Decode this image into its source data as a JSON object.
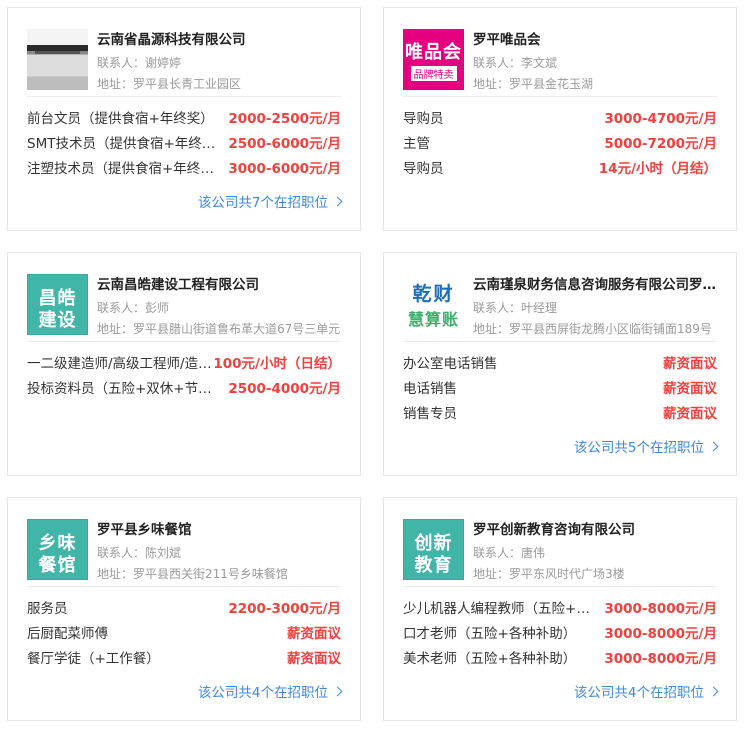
{
  "more_suffix_icon": "chevron-right-icon",
  "companies": [
    {
      "name": "云南省晶源科技有限公司",
      "contact": "联系人：谢婷婷",
      "address": "地址：罗平县长青工业园区",
      "logo": {
        "kind": "photo"
      },
      "jobs": [
        {
          "title": "前台文员（提供食宿+年终奖）",
          "salary": "2000-2500元/月"
        },
        {
          "title": "SMT技术员（提供食宿+年终奖）",
          "salary": "2500-6000元/月"
        },
        {
          "title": "注塑技术员（提供食宿+年终奖）",
          "salary": "3000-6000元/月"
        }
      ],
      "more": "该公司共7个在招职位"
    },
    {
      "name": "罗平唯品会",
      "contact": "联系人：李文斌",
      "address": "地址：罗平县金花玉湖",
      "logo": {
        "kind": "vip",
        "line1": "唯品会",
        "line2": "品牌特卖"
      },
      "jobs": [
        {
          "title": "导购员",
          "salary": "3000-4700元/月"
        },
        {
          "title": "主管",
          "salary": "5000-7200元/月"
        },
        {
          "title": "导购员",
          "salary": "14元/小时（月结）"
        }
      ],
      "more": ""
    },
    {
      "name": "云南昌皓建设工程有限公司",
      "contact": "联系人：彭师",
      "address": "地址：罗平县腊山街道鲁布革大道67号三单元",
      "logo": {
        "kind": "teal",
        "line1": "昌皓",
        "line2": "建设"
      },
      "jobs": [
        {
          "title": "一二级建造师/高级工程师/造价师",
          "salary": "100元/小时（日结）"
        },
        {
          "title": "投标资料员（五险+双休+节假日）",
          "salary": "2500-4000元/月"
        }
      ],
      "more": ""
    },
    {
      "name": "云南瑾泉财务信息咨询服务有限公司罗平分公司",
      "contact": "联系人：叶经理",
      "address": "地址：罗平县西屏街龙腾小区临街铺面189号",
      "logo": {
        "kind": "finance",
        "line1": "乾财",
        "line2": "慧算账"
      },
      "jobs": [
        {
          "title": "办公室电话销售",
          "salary": "薪资面议"
        },
        {
          "title": "电话销售",
          "salary": "薪资面议"
        },
        {
          "title": "销售专员",
          "salary": "薪资面议"
        }
      ],
      "more": "该公司共5个在招职位"
    },
    {
      "name": "罗平县乡味餐馆",
      "contact": "联系人：陈刘斌",
      "address": "地址：罗平县西关街211号乡味餐馆",
      "logo": {
        "kind": "teal",
        "line1": "乡味",
        "line2": "餐馆"
      },
      "jobs": [
        {
          "title": "服务员",
          "salary": "2200-3000元/月"
        },
        {
          "title": "后厨配菜师傅",
          "salary": "薪资面议"
        },
        {
          "title": "餐厅学徒（+工作餐）",
          "salary": "薪资面议"
        }
      ],
      "more": "该公司共4个在招职位"
    },
    {
      "name": "罗平创新教育咨询有限公司",
      "contact": "联系人：唐伟",
      "address": "地址：罗平东风时代广场3楼",
      "logo": {
        "kind": "teal",
        "line1": "创新",
        "line2": "教育"
      },
      "jobs": [
        {
          "title": "少儿机器人编程教师（五险+双休）",
          "salary": "3000-8000元/月"
        },
        {
          "title": "口才老师（五险+各种补助）",
          "salary": "3000-8000元/月"
        },
        {
          "title": "美术老师（五险+各种补助）",
          "salary": "3000-8000元/月"
        }
      ],
      "more": "该公司共4个在招职位"
    }
  ]
}
